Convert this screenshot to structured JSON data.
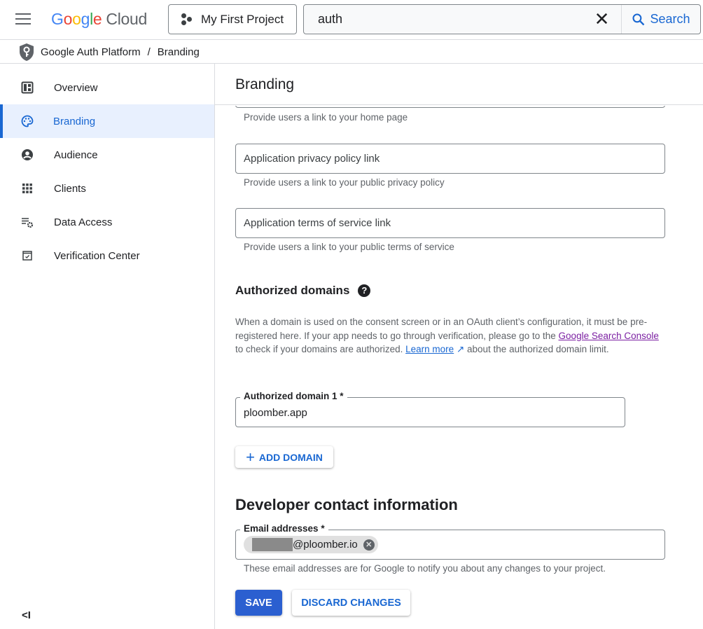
{
  "header": {
    "logo": {
      "g1": "G",
      "o1": "o",
      "o2": "o",
      "g2": "g",
      "l": "l",
      "e": "e",
      "cloud": "Cloud"
    },
    "project": "My First Project",
    "search": {
      "value": "auth",
      "button": "Search"
    }
  },
  "breadcrumb": {
    "root": "Google Auth Platform",
    "separator": "/",
    "current": "Branding"
  },
  "sidebar": {
    "items": [
      {
        "label": "Overview",
        "icon": "dashboard-icon"
      },
      {
        "label": "Branding",
        "icon": "palette-icon",
        "active": true
      },
      {
        "label": "Audience",
        "icon": "account-circle-icon"
      },
      {
        "label": "Clients",
        "icon": "apps-grid-icon"
      },
      {
        "label": "Data Access",
        "icon": "list-settings-icon"
      },
      {
        "label": "Verification Center",
        "icon": "check-box-icon"
      }
    ],
    "collapse": "<I"
  },
  "main": {
    "title": "Branding",
    "home_hint": "Provide users a link to your home page",
    "privacy": {
      "placeholder": "Application privacy policy link",
      "hint": "Provide users a link to your public privacy policy"
    },
    "terms": {
      "placeholder": "Application terms of service link",
      "hint": "Provide users a link to your public terms of service"
    },
    "authorized_domains": {
      "heading": "Authorized domains",
      "desc_1": "When a domain is used on the consent screen or in an OAuth client’s configuration, it must be pre-registered here. If your app needs to go through verification, please go to the ",
      "link_console": "Google Search Console",
      "desc_2": " to check if your domains are authorized. ",
      "link_learn": "Learn more",
      "desc_3": " about the authorized domain limit.",
      "domain1_label": "Authorized domain 1 *",
      "domain1_value": "ploomber.app",
      "add_button": "ADD DOMAIN"
    },
    "developer": {
      "heading": "Developer contact information",
      "email_label": "Email addresses *",
      "email_chip": "@ploomber.io",
      "hint": "These email addresses are for Google to notify you about any changes to your project."
    },
    "save": "SAVE",
    "discard": "DISCARD CHANGES"
  },
  "colors": {
    "accent": "#1967d2",
    "active_bg": "#e8f0fe",
    "save_bg": "#2b5fd0",
    "link_visited": "#7b1fa2"
  }
}
